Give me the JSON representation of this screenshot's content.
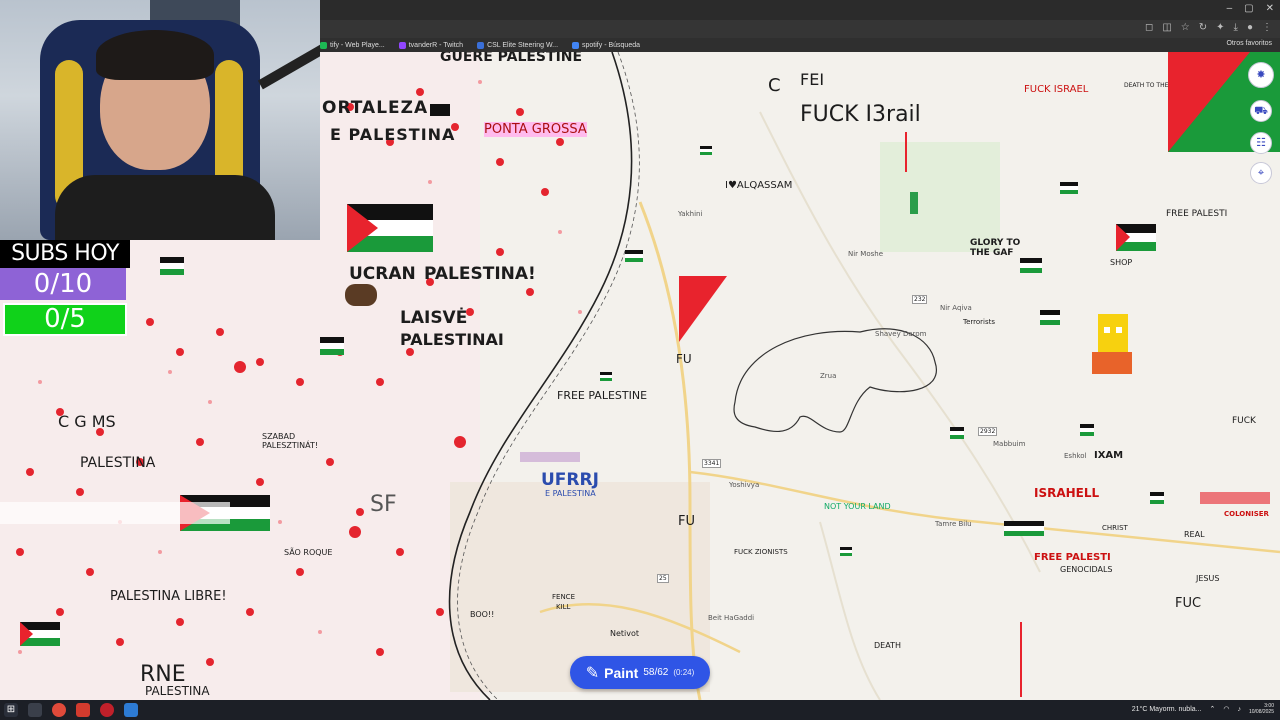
{
  "browser": {
    "bookmarks": [
      {
        "label": "tify - Web Playe...",
        "color": "#1db954"
      },
      {
        "label": "tvanderR - Twitch",
        "color": "#9146ff"
      },
      {
        "label": "CSL Elite Steering W...",
        "color": "#3a6fd8"
      },
      {
        "label": "spotify - Búsqueda",
        "color": "#4285f4"
      }
    ],
    "other_bookmarks": "Otros favoritos"
  },
  "overlay": {
    "subs_title": "SUBS HOY",
    "subs_goal_1": "0/10",
    "subs_goal_2": "0/5"
  },
  "map": {
    "labels": {
      "guerre": "GUERE PALESTINE",
      "fortaleza": "ORTALEZA",
      "e_palestina": "E PALESTINA",
      "ponta": "PONTA GROSSA",
      "palestina_main": "PALESTINA!",
      "ucrania": "UCRAN",
      "laisve": "LAISVĖ",
      "laisve_palestina": "PALESTINAI",
      "free_palestine": "FREE PALESTINE",
      "ufrrj": "UFRRJ",
      "ufrrj_sub": "E PALESTINA",
      "fuck_israel_top": "FUCK I3rail",
      "fei": "FEI",
      "c": "C",
      "i_love": "I♥ALQASSAM",
      "free_palest": "FREE PALESTI",
      "israhell": "ISRAHELL",
      "free_palestine_right": "FREE PALESTI",
      "genocidals": "GENOCIDALS",
      "not_your_land": "NOT YOUR LAND",
      "fuck_zionists": "FUCK ZIONISTS",
      "netivot": "Netivot",
      "yoshivya": "Yoshivya",
      "tamre_bilu": "Tamre Bilu",
      "beit_hagaddi": "Beit HaGaddi",
      "mabbuim": "Mabbuim",
      "eshkol": "Eshkol",
      "nir_moshe": "Nir Moshe",
      "nir_aqiva": "Nir Aqiva",
      "zrua": "Zrua",
      "shavey_darom": "Shavey Darom",
      "yakhini": "Yakhini",
      "fuc": "FUC",
      "death": "DEATH",
      "fu_mid": "FU",
      "fu_low": "FU",
      "boo": "BOO!!",
      "fence": "FENCE",
      "kill": "KILL",
      "jesus": "JESUS",
      "christ": "CHRIST",
      "real": "REAL",
      "fuck_right": "FUCK",
      "colonizer": "COLONISER",
      "shop": "SHOP",
      "free_palesti_top": "FREE PALESTI",
      "fuck_israel_r": "FUCK ISRAEL",
      "death_to": "DEATH TO THE",
      "glory": "GLORY TO THE GAF",
      "terrorists": "Terrorists",
      "zxam": "IXAM",
      "arne": "RNE",
      "palestina_bottom": "PALESTINA",
      "palestina_libre": "PALESTINA LIBRE!",
      "palestina_left": "PALESTINA",
      "cgms": "C G MS",
      "sabado": "SZABAD PALESZTINÁT!",
      "sao_roque": "SÃO ROQUE",
      "sf": "SF",
      "road_232": "232",
      "road_25": "25",
      "road_3341": "3341",
      "road_2932": "2932"
    }
  },
  "paint_button": {
    "label": "Paint",
    "count": "58/62",
    "time": "(0:24)"
  },
  "taskbar": {
    "weather": "21°C  Mayorm. nubla...",
    "time": "3:00",
    "date": "10/08/2025"
  },
  "colors": {
    "accent": "#2f55e6",
    "subs_purple": "#8e63d6",
    "subs_green": "#10d21a",
    "flag_red": "#e8232d",
    "flag_green": "#1a9a3a"
  }
}
